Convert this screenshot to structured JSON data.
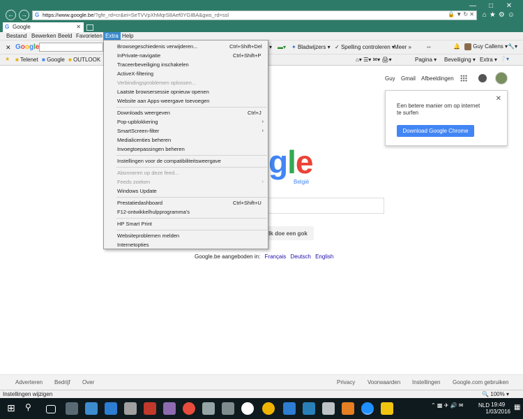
{
  "browser": {
    "address_url_host": "https://www.google.be",
    "address_url_rest": "/?gfe_rd=cr&ei=SeTVVpXhMqrS8Aef0YGIBA&gws_rd=ssl",
    "tab_title": "Google"
  },
  "menubar": [
    "Bestand",
    "Bewerken",
    "Beeld",
    "Favorieten",
    "Extra",
    "Help"
  ],
  "toolbar": {
    "google_label": "Google",
    "bookmarks": "Bladwijzers",
    "spell": "Spelling controleren",
    "more": "Meer",
    "user": "Guy Callens"
  },
  "favorites_bar": [
    "Telenet",
    "Google",
    "OUTLOOK"
  ],
  "command_bar": [
    "Pagina",
    "Beveiliging",
    "Extra"
  ],
  "extra_menu": [
    {
      "label": "Browsegeschiedenis verwijderen...",
      "shortcut": "Ctrl+Shift+Del"
    },
    {
      "label": "InPrivate-navigatie",
      "shortcut": "Ctrl+Shift+P"
    },
    {
      "label": "Traceerbeveiliging inschakelen"
    },
    {
      "label": "ActiveX-filtering"
    },
    {
      "label": "Verbindingsproblemen oplossen...",
      "disabled": true
    },
    {
      "label": "Laatste browsersessie opnieuw openen"
    },
    {
      "label": "Website aan Apps-weergave toevoegen"
    },
    {
      "label": "Downloads weergeven",
      "shortcut": "Ctrl+J"
    },
    {
      "label": "Pop-upblokkering",
      "submenu": true
    },
    {
      "label": "SmartScreen-filter",
      "submenu": true
    },
    {
      "label": "Medialicenties beheren"
    },
    {
      "label": "Invoegtoepassingen beheren"
    },
    {
      "label": "Instellingen voor de compatibiliteitsweergave"
    },
    {
      "label": "Abonneren op deze feed...",
      "disabled": true
    },
    {
      "label": "Feeds zoeken",
      "disabled": true,
      "submenu": true
    },
    {
      "label": "Windows Update"
    },
    {
      "label": "Prestatiedashboard",
      "shortcut": "Ctrl+Shift+U"
    },
    {
      "label": "F12-ontwikkelhulpprogramma's"
    },
    {
      "label": "HP Smart Print"
    },
    {
      "label": "Websiteproblemen melden"
    },
    {
      "label": "Internetopties"
    }
  ],
  "google_page": {
    "user_name": "Guy",
    "gmail": "Gmail",
    "images": "Afbeeldingen",
    "promo_text": "Een betere manier om op internet te surfen",
    "promo_button": "Download Google Chrome",
    "logo_region": "België",
    "lucky_button": "Ik doe een gok",
    "offered_in": "Google.be aangeboden in:",
    "languages": [
      "Français",
      "Deutsch",
      "English"
    ],
    "footer_left": [
      "Adverteren",
      "Bedrijf",
      "Over"
    ],
    "footer_right": [
      "Privacy",
      "Voorwaarden",
      "Instellingen",
      "Google.com gebruiken"
    ]
  },
  "statusbar": {
    "text": "Instellingen wijzigen",
    "zoom": "100%"
  },
  "taskbar": {
    "lang": "NLD",
    "time": "19:49",
    "date": "1/03/2016"
  },
  "colors": {
    "chrome": "#2e7a68",
    "menu_highlight": "#3c8cd0",
    "google_blue": "#4285f4"
  }
}
